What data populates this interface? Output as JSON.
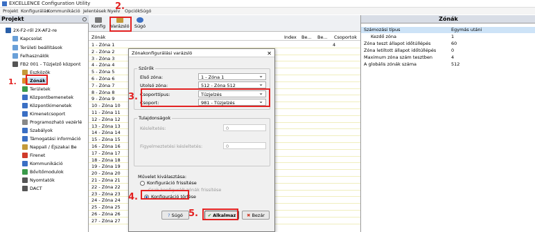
{
  "window": {
    "title": "EXCELLENCE Configuration Utility"
  },
  "menu": [
    "Projekt",
    "Konfigurálás",
    "Kommunikáció",
    "Jelentések",
    "Nyelv",
    "Opciók",
    "Súgó"
  ],
  "project": {
    "header": "Projekt",
    "items": [
      "2X-F2-ről 2X-AF2-re",
      "Kapcsolat",
      "Területi beállítások",
      "Felhasználók",
      "FB2 001 - Tűzjelző központ",
      "Eszközök",
      "Zónák",
      "Területek",
      "Központbemenetek",
      "Központkimenetek",
      "Kimenetcsoport",
      "Programozható vezérlé",
      "Szabályok",
      "Támogatási információ",
      "Nappali / Éjszakai Be",
      "Firenet",
      "Kommunikáció",
      "Bővítőmodulok",
      "Nyomtatók",
      "DACT"
    ]
  },
  "toolbar": {
    "konfig": "Konfig",
    "varazslo": "Varázsló",
    "sugo": "Súgó"
  },
  "zone_table": {
    "headers": {
      "zonak": "Zónák",
      "index": "Index",
      "be": "Be...",
      "be2": "Be...",
      "csoport": "Csoportok",
      "csoport_val": "4"
    },
    "rows": [
      "1 - Zóna 1",
      "2 - Zóna 2",
      "3 - Zóna 3",
      "4 - Zóna 4",
      "5 - Zóna 5",
      "6 - Zóna 6",
      "7 - Zóna 7",
      "8 - Zóna 8",
      "9 - Zóna 9",
      "10 - Zóna 10",
      "11 - Zóna 11",
      "12 - Zóna 12",
      "13 - Zóna 13",
      "14 - Zóna 14",
      "15 - Zóna 15",
      "16 - Zóna 16",
      "17 - Zóna 17",
      "18 - Zóna 18",
      "19 - Zóna 19",
      "20 - Zóna 20",
      "21 - Zóna 21",
      "22 - Zóna 22",
      "23 - Zóna 23",
      "24 - Zóna 24",
      "25 - Zóna 25",
      "26 - Zóna 26",
      "27 - Zóna 27"
    ]
  },
  "right_pane": {
    "header": "Zónák",
    "col_key": "Számozási típus",
    "col_val": "Egymás utáni",
    "rows": [
      {
        "k": "Kezdő zóna",
        "v": "1"
      },
      {
        "k": "Zóna teszt állapot időtúllépés",
        "v": "60"
      },
      {
        "k": "Zóna letiltott állapot időtúllépés",
        "v": "0"
      },
      {
        "k": "Maximum zóna szám tesztben",
        "v": "4"
      },
      {
        "k": "A globális zónák száma",
        "v": "512"
      }
    ]
  },
  "dialog": {
    "title": "Zónakonfigurálási varázsló",
    "szures": "Szűrők",
    "elso_label": "Első zóna:",
    "elso_val": "1 - Zóna 1",
    "utolso_label": "Utolsó zóna:",
    "utolso_val": "512 - Zóna 512",
    "csoporttipus_label": "Csoporttípus:",
    "csoporttipus_val": "Tűzjelzés",
    "csoport_label": "Csoport:",
    "csoport_val": "981 - Tűzjelzés",
    "tulajdonsagok": "Tulajdonságok",
    "kesleltetes_label": "Késleltetés:",
    "kesleltetes_val": "0",
    "figyelm_label": "Figyelmeztetési késleltetés:",
    "figyelm_val": "0",
    "muvelet": "Művelet kiválasztása:",
    "opt1": "Konfiguráció frissítése",
    "opt2": "Csak konfigurált zónák frissítése",
    "opt3": "Konfiguráció törlése",
    "btn_sugo": "Súgó",
    "btn_alkalmaz": "Alkalmaz",
    "btn_bezar": "Bezár"
  },
  "annotations": [
    "1.",
    "2.",
    "3.",
    "4.",
    "5."
  ]
}
